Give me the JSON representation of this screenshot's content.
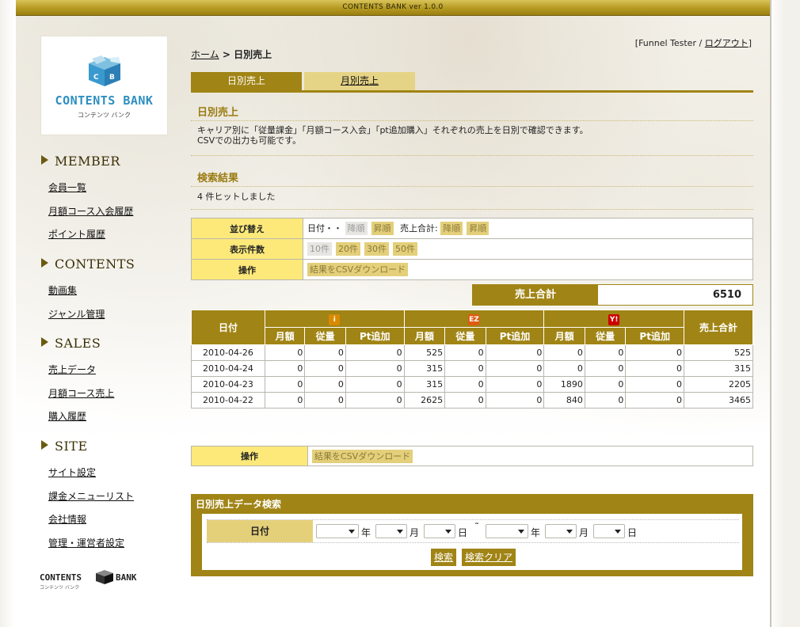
{
  "app": {
    "version_label": "CONTENTS BANK ver 1.0.0"
  },
  "logo": {
    "text": "CONTENTS BANK",
    "sub": "コンテンツ バンク",
    "cube_letters": "CB"
  },
  "header": {
    "user": "Funnel Tester",
    "separator": "/",
    "logout": "ログアウト"
  },
  "breadcrumb": {
    "home": "ホーム",
    "sep": " > ",
    "current": "日別売上"
  },
  "tabs": [
    {
      "label": "日別売上",
      "active": true
    },
    {
      "label": "月別売上",
      "active": false
    }
  ],
  "sidebar": {
    "sections": [
      {
        "title": "MEMBER",
        "items": [
          "会員一覧",
          "月額コース入会履歴",
          "ポイント履歴"
        ]
      },
      {
        "title": "CONTENTS",
        "items": [
          "動画集",
          "ジャンル管理"
        ]
      },
      {
        "title": "SALES",
        "items": [
          "売上データ",
          "月額コース売上",
          "購入履歴"
        ]
      },
      {
        "title": "SITE",
        "items": [
          "サイト設定",
          "課金メニューリスト",
          "会社情報",
          "管理・運営者設定"
        ]
      }
    ],
    "footer_logo": {
      "left": "CONTENTS",
      "right": "BANK",
      "sub": "コンテンツ バンク"
    }
  },
  "main": {
    "title": "日別売上",
    "description": [
      "キャリア別に「従量課金」「月額コース入会」「pt追加購入」それぞれの売上を日別で確認できます。",
      "CSVでの出力も可能です。"
    ],
    "results_title": "検索結果",
    "results_count": "4 件ヒットしました",
    "options": {
      "sort": {
        "label": "並び替え",
        "date_label": "日付・・",
        "desc": "降順",
        "asc": "昇順",
        "total_label": "売上合計:",
        "total_desc": "降順",
        "total_asc": "昇順"
      },
      "per_page": {
        "label": "表示件数",
        "choices": [
          "10件",
          "20件",
          "30件",
          "50件"
        ]
      },
      "action": {
        "label": "操作",
        "csv": "結果をCSVダウンロード"
      }
    },
    "total": {
      "label": "売上合計",
      "value": "6510"
    },
    "table": {
      "date_header": "日付",
      "total_header": "売上合計",
      "carriers": [
        {
          "name": "i-mode",
          "color": "#d98a00",
          "glyph": "i"
        },
        {
          "name": "EZweb",
          "color": "#e05a10",
          "glyph": "EZ"
        },
        {
          "name": "Y!",
          "color": "#cc0000",
          "glyph": "Y!"
        }
      ],
      "subheaders": [
        "月額",
        "従量",
        "Pt追加"
      ],
      "rows": [
        {
          "date": "2010-04-26",
          "vals": [
            "0",
            "0",
            "0",
            "525",
            "0",
            "0",
            "0",
            "0",
            "0"
          ],
          "total": "525"
        },
        {
          "date": "2010-04-24",
          "vals": [
            "0",
            "0",
            "0",
            "315",
            "0",
            "0",
            "0",
            "0",
            "0"
          ],
          "total": "315"
        },
        {
          "date": "2010-04-23",
          "vals": [
            "0",
            "0",
            "0",
            "315",
            "0",
            "0",
            "1890",
            "0",
            "0"
          ],
          "total": "2205"
        },
        {
          "date": "2010-04-22",
          "vals": [
            "0",
            "0",
            "0",
            "2625",
            "0",
            "0",
            "840",
            "0",
            "0"
          ],
          "total": "3465"
        }
      ]
    },
    "bottom_action": {
      "label": "操作",
      "csv": "結果をCSVダウンロード"
    },
    "search": {
      "title": "日別売上データ検索",
      "date_label": "日付",
      "units": {
        "year": "年",
        "month": "月",
        "day": "日",
        "tilde": "˜"
      },
      "search_button": "検索",
      "clear_button": "検索クリア"
    }
  }
}
